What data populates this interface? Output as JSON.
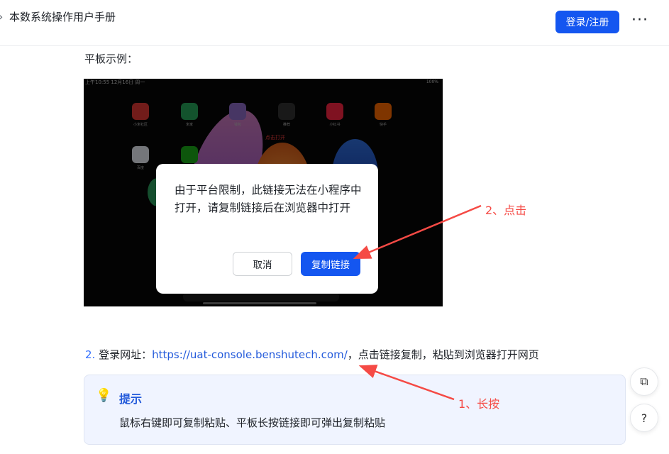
{
  "header": {
    "title": "本数系统操作用户手册",
    "login_label": "登录/注册",
    "more_label": "···"
  },
  "main": {
    "section_label": "平板示例：",
    "screenshot": {
      "status_time": "上午10:55 12月16日 周一",
      "status_right": "100%",
      "apps": [
        {
          "label": "小米社区",
          "color": "#e53935",
          "text": "社区"
        },
        {
          "label": "米家",
          "color": "#26a65b",
          "text": "米"
        },
        {
          "label": "钱包",
          "color": "#8e6cc8",
          "text": ""
        },
        {
          "label": "推荐",
          "color": "#333333",
          "text": ""
        },
        {
          "label": "小红书",
          "color": "#ff2442",
          "text": "小红书"
        },
        {
          "label": "快手",
          "color": "#ff6a00",
          "text": ""
        },
        {
          "label": "百度",
          "color": "#e9ecf5",
          "text": ""
        },
        {
          "label": "微信",
          "color": "#1aad19",
          "text": ""
        }
      ],
      "tap_hint": "点击打开"
    },
    "dialog": {
      "message": "由于平台限制，此链接无法在小程序中打开，请复制链接后在浏览器中打开",
      "cancel_label": "取消",
      "copy_label": "复制链接"
    },
    "step2": {
      "number": "2.",
      "prefix": "登录网址：",
      "link": "https://uat-console.benshutech.com/",
      "suffix": "，点击链接复制，粘贴到浏览器打开网页"
    },
    "tip": {
      "icon": "lightbulb-icon",
      "title": "提示",
      "body": "鼠标右键即可复制粘贴、平板长按链接即可弹出复制粘贴"
    },
    "annotations": {
      "click": "2、点击",
      "long_press": "1、长按"
    }
  },
  "side_tools": [
    {
      "icon": "copy-page-icon"
    },
    {
      "icon": "help-icon"
    }
  ],
  "colors": {
    "accent": "#1456f0",
    "link": "#245bdb",
    "annotation": "#f54a45",
    "tip_bg": "#f0f4ff"
  }
}
